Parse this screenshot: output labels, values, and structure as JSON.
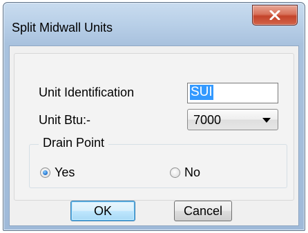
{
  "dialog": {
    "title": "Split Midwall Units",
    "close_label": "X"
  },
  "form": {
    "unit_identification": {
      "label": "Unit Identification",
      "value": "SUI"
    },
    "unit_btu": {
      "label": "Unit Btu:-",
      "selected": "7000"
    },
    "drain_point": {
      "title": "Drain Point",
      "options": [
        {
          "label": "Yes",
          "checked": true
        },
        {
          "label": "No",
          "checked": false
        }
      ]
    }
  },
  "buttons": {
    "ok_label": "OK",
    "cancel_label": "Cancel"
  },
  "colors": {
    "selection": "#3399ff",
    "close_button": "#c4432a",
    "title_bar": "#b9d0e8"
  }
}
